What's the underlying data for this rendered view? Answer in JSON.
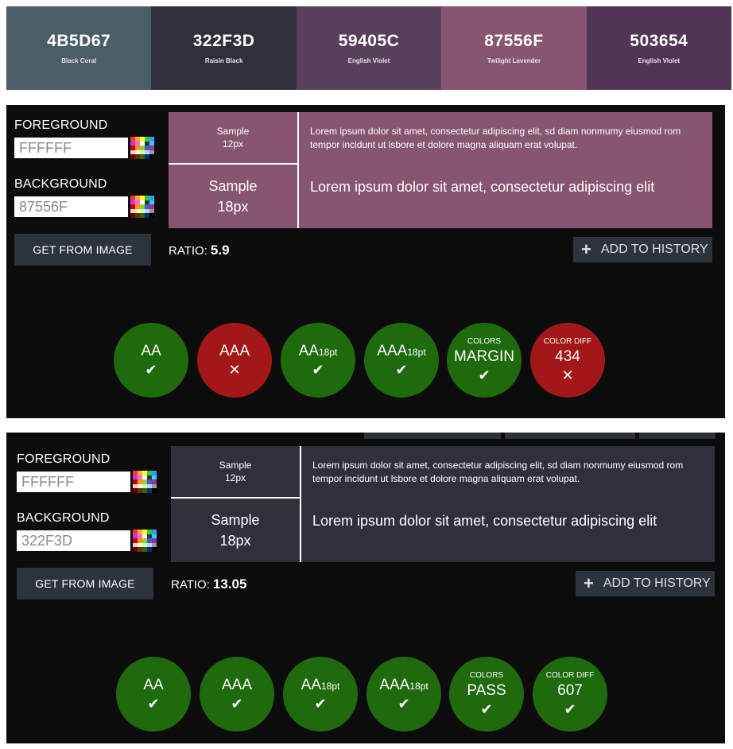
{
  "palette": [
    {
      "hex": "4B5D67",
      "name": "Black Coral",
      "color": "#4B5D67"
    },
    {
      "hex": "322F3D",
      "name": "Raisin Black",
      "color": "#322F3D"
    },
    {
      "hex": "59405C",
      "name": "English Violet",
      "color": "#59405C"
    },
    {
      "hex": "87556F",
      "name": "Twilight Lavender",
      "color": "#87556F"
    },
    {
      "hex": "503654",
      "name": "English Violet",
      "color": "#503654"
    }
  ],
  "checker1": {
    "foreground_label": "FOREGROUND",
    "foreground_value": "FFFFFF",
    "background_label": "BACKGROUND",
    "background_value": "87556F",
    "get_from_image": "GET FROM IMAGE",
    "sample_small_label": "Sample",
    "sample_small_size": "12px",
    "sample_large_label": "Sample",
    "sample_large_size": "18px",
    "text_small": "Lorem ipsum dolor sit amet, consectetur adipiscing elit, sd diam nonmumy eiusmod rom tempor incidunt ut lsbore et dolore magna aliquam erat volupat.",
    "text_large": "Lorem ipsum dolor sit amet, consectetur adipiscing elit",
    "ratio_label": "RATIO:",
    "ratio_value": "5.9",
    "add_history": "ADD TO HISTORY",
    "sample_bg": "#87556F",
    "badges": {
      "aa": {
        "label": "AA",
        "mark": "✔"
      },
      "aaa": {
        "label": "AAA",
        "mark": "✕"
      },
      "aa18_main": "AA",
      "aa18_sub": "18pt",
      "aa18_mark": "✔",
      "aaa18_main": "AAA",
      "aaa18_sub": "18pt",
      "aaa18_mark": "✔",
      "colors": {
        "top": "COLORS",
        "label": "MARGIN",
        "mark": "✔"
      },
      "diff": {
        "top": "COLOR DIFF",
        "label": "434",
        "mark": "✕"
      }
    }
  },
  "checker2": {
    "foreground_label": "FOREGROUND",
    "foreground_value": "FFFFFF",
    "background_label": "BACKGROUND",
    "background_value": "322F3D",
    "get_from_image": "GET FROM IMAGE",
    "sample_small_label": "Sample",
    "sample_small_size": "12px",
    "sample_large_label": "Sample",
    "sample_large_size": "18px",
    "text_small": "Lorem ipsum dolor sit amet, consectetur adipiscing elit, sd diam nonmumy eiusmod rom tempor incidunt ut lsbore et dolore magna aliquam erat volupat.",
    "text_large": "Lorem ipsum dolor sit amet, consectetur adipiscing elit",
    "ratio_label": "RATIO:",
    "ratio_value": "13.05",
    "add_history": "ADD TO HISTORY",
    "sample_bg": "#322F3D",
    "badges": {
      "aa": {
        "label": "AA",
        "mark": "✔"
      },
      "aaa": {
        "label": "AAA",
        "mark": "✔"
      },
      "aa18_main": "AA",
      "aa18_sub": "18pt",
      "aa18_mark": "✔",
      "aaa18_main": "AAA",
      "aaa18_sub": "18pt",
      "aaa18_mark": "✔",
      "colors": {
        "top": "COLORS",
        "label": "PASS",
        "mark": "✔"
      },
      "diff": {
        "top": "COLOR DIFF",
        "label": "607",
        "mark": "✔"
      }
    }
  },
  "colors": {
    "pass": "#1e6a0d",
    "fail": "#a31717",
    "panel": "#0c0c0c",
    "button": "#2d333c"
  }
}
